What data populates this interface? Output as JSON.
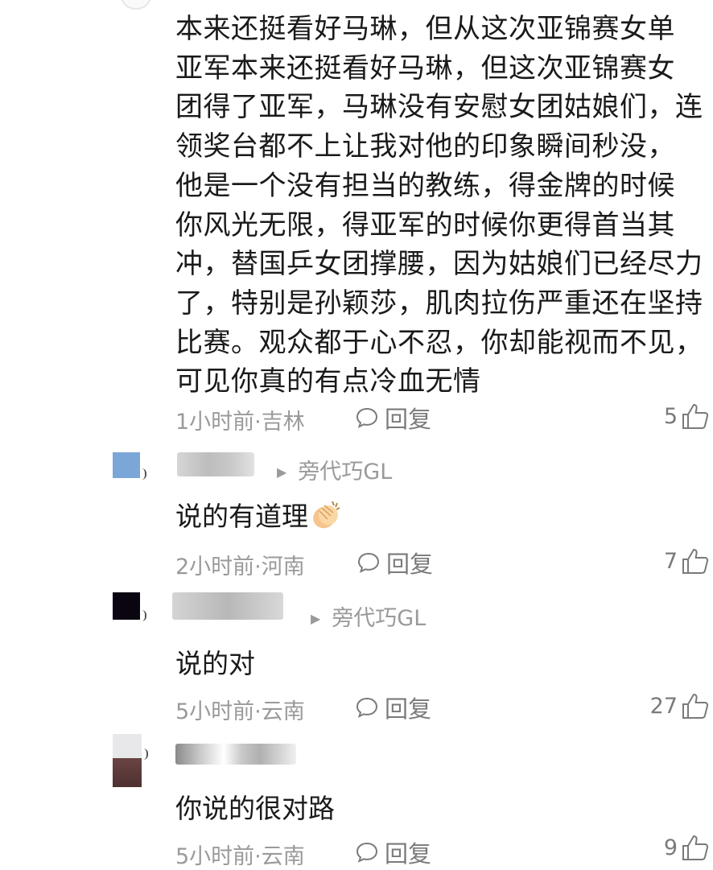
{
  "main_comment": {
    "text": "本来还挺看好马琳，但从这次亚锦赛女单\n亚军本来还挺看好马琳，但这次亚锦赛女\n团得了亚军，马琳没有安慰女团姑娘们，连\n领奖台都不上让我对他的印象瞬间秒没，\n他是一个没有担当的教练，得金牌的时候\n你风光无限，得亚军的时候你更得首当其\n冲，替国乒女团撑腰，因为姑娘们已经尽力\n了，特别是孙颖莎，肌肉拉伤严重还在坚持\n比赛。观众都于心不忍，你却能视而不见，\n可见你真的有点冷血无情",
    "meta": "1小时前·吉林",
    "reply_label": "回复",
    "likes": "5"
  },
  "replies": [
    {
      "reply_to": "旁代巧GL",
      "text": "说的有道理",
      "emoji": "clapping-hands",
      "meta": "2小时前·河南",
      "reply_label": "回复",
      "likes": "7",
      "avatar_color": "#7aa6d8"
    },
    {
      "reply_to": "旁代巧GL",
      "text": "说的对",
      "meta": "5小时前·云南",
      "reply_label": "回复",
      "likes": "27",
      "avatar_color": "#0a0510"
    },
    {
      "text": "你说的很对路",
      "meta": "5小时前·云南",
      "reply_label": "回复",
      "likes": "9",
      "avatar_color": "#5a3a3a"
    }
  ],
  "colors": {
    "text": "#1a1a1a",
    "meta": "#9a9a9a",
    "icon": "#7a7a7a"
  }
}
